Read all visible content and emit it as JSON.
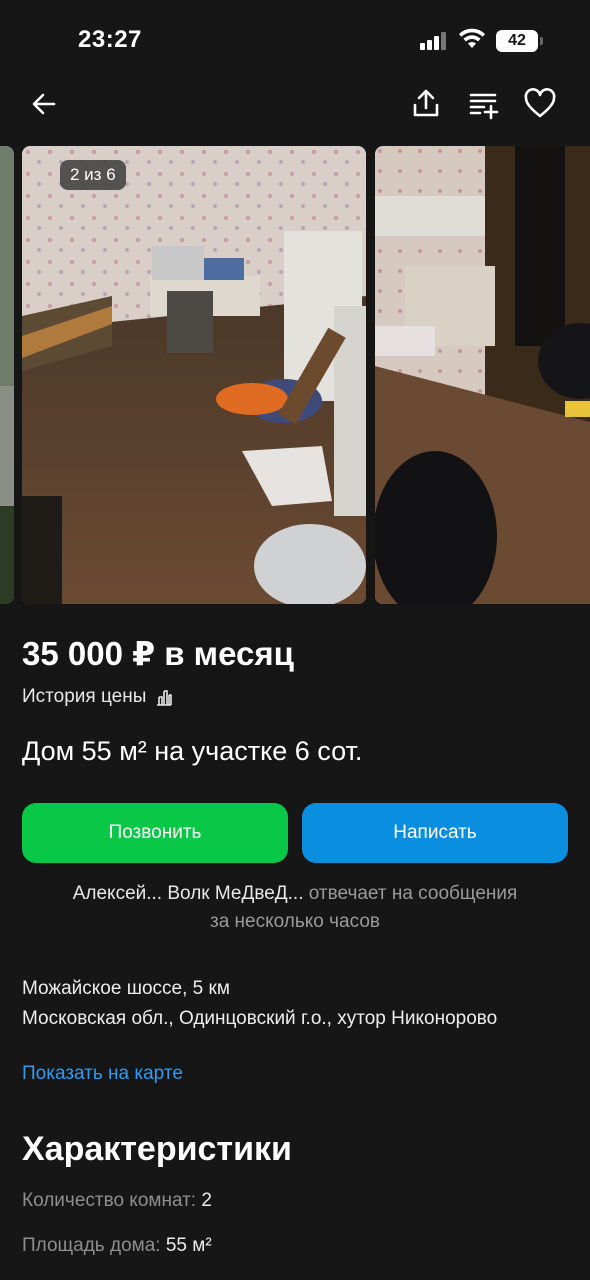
{
  "status_bar": {
    "time": "23:27",
    "battery": "42"
  },
  "gallery": {
    "counter": "2 из 6"
  },
  "listing": {
    "price": "35 000 ₽ в месяц",
    "price_history_label": "История цены",
    "title": "Дом 55 м² на участке 6 сот."
  },
  "actions": {
    "call_label": "Позвонить",
    "write_label": "Написать"
  },
  "seller": {
    "name": "Алексей... Волк МеДвеД...",
    "response": "отвечает на сообщения",
    "response_time": "за несколько часов"
  },
  "address": {
    "line1": "Можайское шоссе, 5 км",
    "line2": "Московская обл., Одинцовский г.о., хутор Никонорово",
    "map_link": "Показать на карте"
  },
  "characteristics": {
    "title": "Характеристики",
    "items": [
      {
        "label": "Количество комнат:",
        "value": "2"
      },
      {
        "label": "Площадь дома:",
        "value": "55 м²"
      }
    ]
  },
  "colors": {
    "call": "#0ac847",
    "write": "#0a8ee0",
    "link": "#2f9bf2",
    "background": "#161616"
  },
  "icons": {
    "back": "arrow-left-icon",
    "share": "share-icon",
    "compare": "compare-icon",
    "favorite": "heart-icon",
    "history": "bar-chart-icon"
  }
}
